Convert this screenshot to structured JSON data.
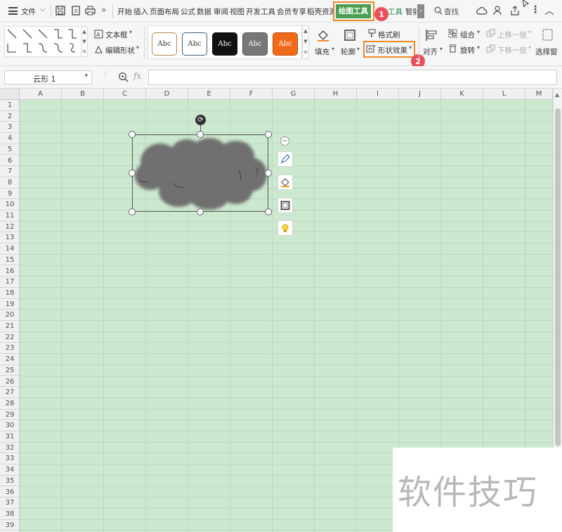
{
  "menubar": {
    "file_label": "文件",
    "tabs": [
      "开始",
      "插入",
      "页面布局",
      "公式",
      "数据",
      "审阅",
      "视图",
      "开发工具",
      "会员专享",
      "稻壳资源"
    ],
    "active_tab": "绘图工具",
    "next_tab": "文本工具",
    "next_tab_visible": "工具",
    "partial_tab": "智能",
    "search_label": "查找"
  },
  "ribbon": {
    "text_box": "文本框",
    "edit_shape": "编辑形状",
    "style_samples": [
      "Abc",
      "Abc",
      "Abc",
      "Abc",
      "Abc"
    ],
    "fill": "填充",
    "outline": "轮廓",
    "format_painter": "格式刷",
    "shape_effects": "形状效果",
    "align": "对齐",
    "group": "组合",
    "rotate": "旋转",
    "bring_forward": "上移一层",
    "send_backward": "下移一层",
    "selection_pane": "选择窗"
  },
  "formula_bar": {
    "name_box": "云形 1",
    "fx_label": "fx",
    "formula_value": ""
  },
  "sheet": {
    "columns": [
      "A",
      "B",
      "C",
      "D",
      "E",
      "F",
      "G",
      "H",
      "I",
      "J",
      "K",
      "L",
      "M"
    ],
    "rows": [
      "1",
      "2",
      "3",
      "4",
      "5",
      "6",
      "7",
      "8",
      "9",
      "10",
      "11",
      "12",
      "13",
      "14",
      "15",
      "16",
      "17",
      "18",
      "19",
      "20",
      "21",
      "22",
      "23",
      "24",
      "25",
      "26",
      "27",
      "28",
      "29",
      "30",
      "31",
      "32",
      "33",
      "34",
      "35",
      "36",
      "37",
      "38",
      "39"
    ]
  },
  "annotations": {
    "step1": "1",
    "step2": "2"
  },
  "watermark": "软件技巧",
  "colors": {
    "active_tab_bg": "#4a9e4f",
    "highlight_orange": "#f08a24",
    "badge_red": "#e8515b",
    "cloud_fill": "#707070",
    "sheet_bg": "#cce8cf"
  }
}
